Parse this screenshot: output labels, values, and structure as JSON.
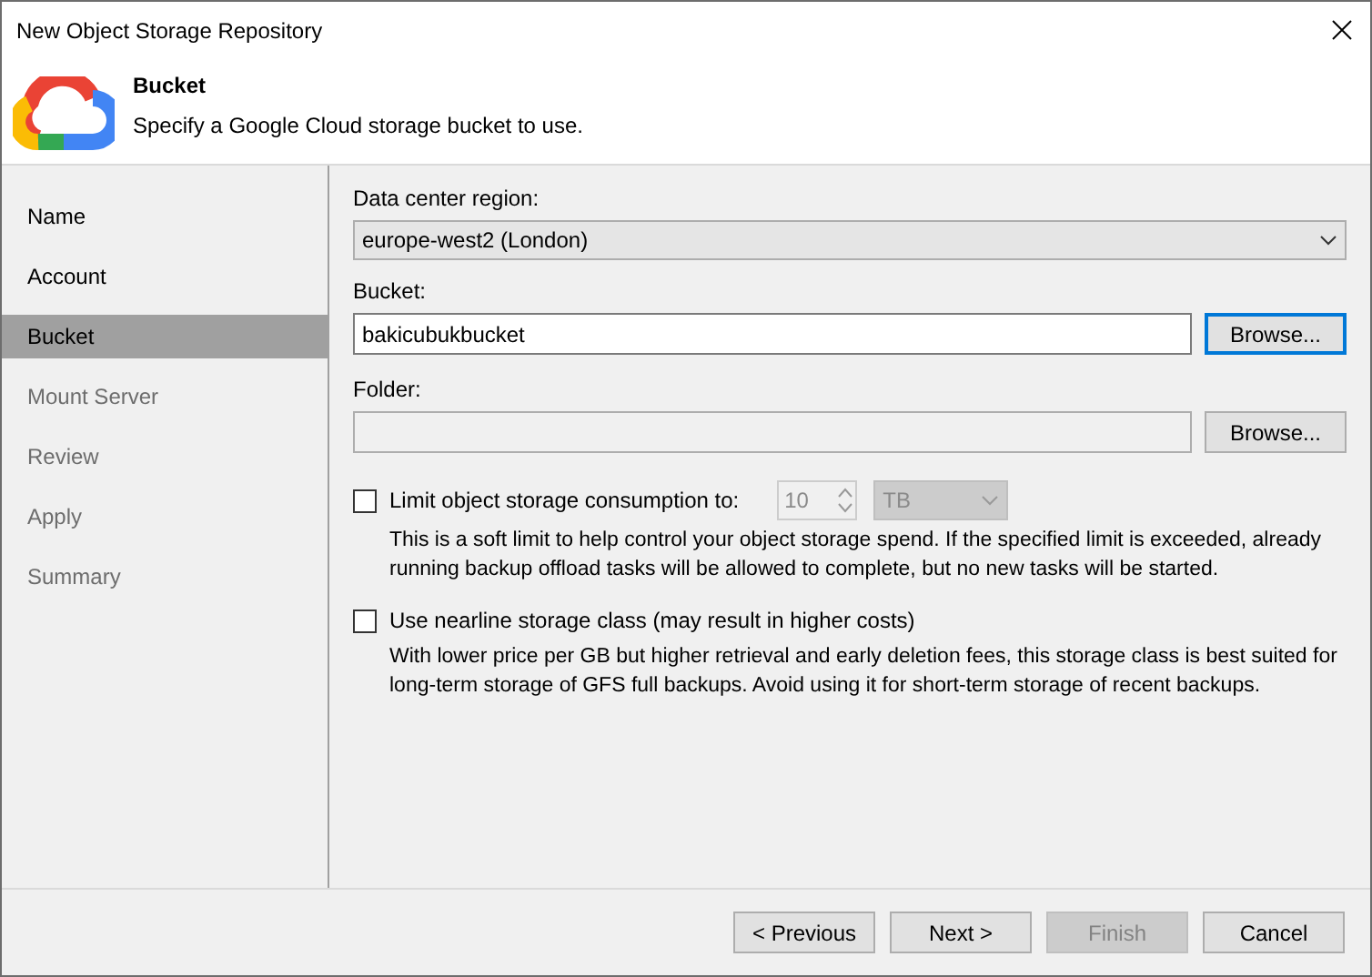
{
  "window": {
    "title": "New Object Storage Repository"
  },
  "header": {
    "title": "Bucket",
    "subtitle": "Specify a Google Cloud storage bucket to use."
  },
  "steps": [
    {
      "label": "Name",
      "selected": false,
      "disabled": false
    },
    {
      "label": "Account",
      "selected": false,
      "disabled": false
    },
    {
      "label": "Bucket",
      "selected": true,
      "disabled": false
    },
    {
      "label": "Mount Server",
      "selected": false,
      "disabled": true
    },
    {
      "label": "Review",
      "selected": false,
      "disabled": true
    },
    {
      "label": "Apply",
      "selected": false,
      "disabled": true
    },
    {
      "label": "Summary",
      "selected": false,
      "disabled": true
    }
  ],
  "region": {
    "label": "Data center region:",
    "value": "europe-west2 (London)"
  },
  "bucket": {
    "label": "Bucket:",
    "value": "bakicubukbucket",
    "button": "Browse...",
    "button_focused": true
  },
  "folder": {
    "label": "Folder:",
    "button": "Browse...",
    "disabled": true
  },
  "limit": {
    "label": "Limit object storage consumption to:",
    "checked": false,
    "amount": "10",
    "unit": "TB",
    "description": "This is a soft limit to help control your object storage spend. If the specified limit is exceeded, already running backup offload tasks will be allowed to complete, but no new tasks will be started."
  },
  "nearline": {
    "label": "Use nearline storage class (may result in higher costs)",
    "checked": false,
    "description": "With lower price per GB but higher retrieval and early deletion fees, this storage class is best suited for long-term storage of GFS full backups. Avoid using it for short-term storage of recent backups."
  },
  "buttons": [
    {
      "label": "< Previous",
      "disabled": false
    },
    {
      "label": "Next >",
      "disabled": false
    },
    {
      "label": "Finish",
      "disabled": true
    },
    {
      "label": "Cancel",
      "disabled": false
    }
  ]
}
